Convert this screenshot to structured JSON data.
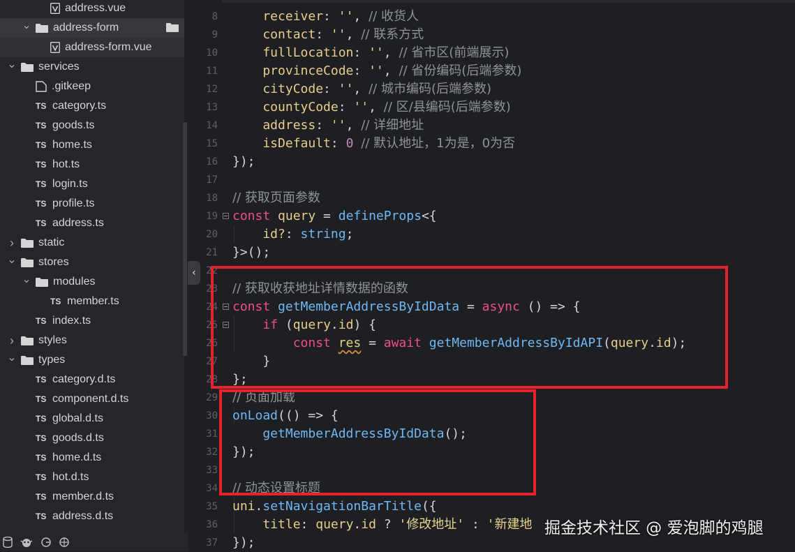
{
  "sidebar": {
    "items": [
      {
        "label": "address.vue",
        "type": "vue",
        "indent": 3,
        "arrow": ""
      },
      {
        "label": "address-form",
        "type": "folder",
        "indent": 2,
        "arrow": "down",
        "state": "hl"
      },
      {
        "label": "address-form.vue",
        "type": "vue",
        "indent": 3,
        "arrow": "",
        "state": "sel"
      },
      {
        "label": "services",
        "type": "folder",
        "indent": 1,
        "arrow": "down"
      },
      {
        "label": ".gitkeep",
        "type": "file",
        "indent": 2,
        "arrow": ""
      },
      {
        "label": "category.ts",
        "type": "ts",
        "indent": 2,
        "arrow": ""
      },
      {
        "label": "goods.ts",
        "type": "ts",
        "indent": 2,
        "arrow": ""
      },
      {
        "label": "home.ts",
        "type": "ts",
        "indent": 2,
        "arrow": ""
      },
      {
        "label": "hot.ts",
        "type": "ts",
        "indent": 2,
        "arrow": ""
      },
      {
        "label": "login.ts",
        "type": "ts",
        "indent": 2,
        "arrow": ""
      },
      {
        "label": "profile.ts",
        "type": "ts",
        "indent": 2,
        "arrow": ""
      },
      {
        "label": "address.ts",
        "type": "ts",
        "indent": 2,
        "arrow": ""
      },
      {
        "label": "static",
        "type": "folder",
        "indent": 1,
        "arrow": "right"
      },
      {
        "label": "stores",
        "type": "folder",
        "indent": 1,
        "arrow": "down"
      },
      {
        "label": "modules",
        "type": "folder",
        "indent": 2,
        "arrow": "down"
      },
      {
        "label": "member.ts",
        "type": "ts",
        "indent": 3,
        "arrow": ""
      },
      {
        "label": "index.ts",
        "type": "ts",
        "indent": 2,
        "arrow": ""
      },
      {
        "label": "styles",
        "type": "folder",
        "indent": 1,
        "arrow": "right"
      },
      {
        "label": "types",
        "type": "folder",
        "indent": 1,
        "arrow": "down"
      },
      {
        "label": "category.d.ts",
        "type": "ts",
        "indent": 2,
        "arrow": ""
      },
      {
        "label": "component.d.ts",
        "type": "ts",
        "indent": 2,
        "arrow": ""
      },
      {
        "label": "global.d.ts",
        "type": "ts",
        "indent": 2,
        "arrow": ""
      },
      {
        "label": "goods.d.ts",
        "type": "ts",
        "indent": 2,
        "arrow": ""
      },
      {
        "label": "home.d.ts",
        "type": "ts",
        "indent": 2,
        "arrow": ""
      },
      {
        "label": "hot.d.ts",
        "type": "ts",
        "indent": 2,
        "arrow": ""
      },
      {
        "label": "member.d.ts",
        "type": "ts",
        "indent": 2,
        "arrow": ""
      },
      {
        "label": "address.d.ts",
        "type": "ts",
        "indent": 2,
        "arrow": ""
      }
    ],
    "ts_badge": "TS",
    "bottom_icons": [
      "database-icon",
      "bug-icon",
      "source-control-icon",
      "plugin-icon"
    ]
  },
  "editor": {
    "line_numbers": [
      "8",
      "9",
      "10",
      "11",
      "12",
      "13",
      "14",
      "15",
      "16",
      "17",
      "18",
      "19",
      "20",
      "21",
      "22",
      "23",
      "24",
      "25",
      "26",
      "27",
      "28",
      "29",
      "30",
      "31",
      "32",
      "33",
      "34",
      "35",
      "36",
      "37"
    ],
    "lines": [
      [
        [
          "pr",
          "    receiver"
        ],
        [
          "pu",
          ": "
        ],
        [
          "st",
          "''"
        ],
        [
          "pu",
          ", "
        ],
        [
          "cm",
          "// 收货人"
        ]
      ],
      [
        [
          "pr",
          "    contact"
        ],
        [
          "pu",
          ": "
        ],
        [
          "st",
          "''"
        ],
        [
          "pu",
          ", "
        ],
        [
          "cm",
          "// 联系方式"
        ]
      ],
      [
        [
          "pr",
          "    fullLocation"
        ],
        [
          "pu",
          ": "
        ],
        [
          "st",
          "''"
        ],
        [
          "pu",
          ", "
        ],
        [
          "cm",
          "// 省市区(前端展示)"
        ]
      ],
      [
        [
          "pr",
          "    provinceCode"
        ],
        [
          "pu",
          ": "
        ],
        [
          "st",
          "''"
        ],
        [
          "pu",
          ", "
        ],
        [
          "cm",
          "// 省份编码(后端参数)"
        ]
      ],
      [
        [
          "pr",
          "    cityCode"
        ],
        [
          "pu",
          ": "
        ],
        [
          "st",
          "''"
        ],
        [
          "pu",
          ", "
        ],
        [
          "cm",
          "// 城市编码(后端参数)"
        ]
      ],
      [
        [
          "pr",
          "    countyCode"
        ],
        [
          "pu",
          ": "
        ],
        [
          "st",
          "''"
        ],
        [
          "pu",
          ", "
        ],
        [
          "cm",
          "// 区/县编码(后端参数)"
        ]
      ],
      [
        [
          "pr",
          "    address"
        ],
        [
          "pu",
          ": "
        ],
        [
          "st",
          "''"
        ],
        [
          "pu",
          ", "
        ],
        [
          "cm",
          "// 详细地址"
        ]
      ],
      [
        [
          "pr",
          "    isDefault"
        ],
        [
          "pu",
          ": "
        ],
        [
          "num",
          "0"
        ],
        [
          "pu",
          " "
        ],
        [
          "cm",
          "// 默认地址，1为是，0为否"
        ]
      ],
      [
        [
          "pu",
          "});"
        ]
      ],
      [],
      [
        [
          "cm",
          "// 获取页面参数"
        ]
      ],
      [
        [
          "kw",
          "const "
        ],
        [
          "var",
          "query"
        ],
        [
          "pu",
          " = "
        ],
        [
          "fn",
          "defineProps"
        ],
        [
          "pu",
          "<{"
        ]
      ],
      [
        [
          "pr",
          "    id?"
        ],
        [
          "pu",
          ": "
        ],
        [
          "ty",
          "string"
        ],
        [
          "pu",
          ";"
        ]
      ],
      [
        [
          "pu",
          "}>();"
        ]
      ],
      [],
      [
        [
          "cm",
          "// 获取收获地址详情数据的函数"
        ]
      ],
      [
        [
          "kw",
          "const "
        ],
        [
          "fn",
          "getMemberAddressByIdData"
        ],
        [
          "pu",
          " = "
        ],
        [
          "kw",
          "async"
        ],
        [
          "pu",
          " () => {"
        ]
      ],
      [
        [
          "kw",
          "    if"
        ],
        [
          "pu",
          " ("
        ],
        [
          "var",
          "query"
        ],
        [
          "pu",
          "."
        ],
        [
          "pr",
          "id"
        ],
        [
          "pu",
          ") {"
        ]
      ],
      [
        [
          "kw",
          "        const "
        ],
        [
          "sq",
          "res"
        ],
        [
          "pu",
          " = "
        ],
        [
          "kw",
          "await "
        ],
        [
          "fn",
          "getMemberAddressByIdAPI"
        ],
        [
          "pu",
          "("
        ],
        [
          "var",
          "query"
        ],
        [
          "pu",
          "."
        ],
        [
          "pr",
          "id"
        ],
        [
          "pu",
          ");"
        ]
      ],
      [
        [
          "pu",
          "    }"
        ]
      ],
      [
        [
          "pu",
          "};"
        ]
      ],
      [
        [
          "cm",
          "// 页面加载"
        ]
      ],
      [
        [
          "fn",
          "onLoad"
        ],
        [
          "pu",
          "(() => {"
        ]
      ],
      [
        [
          "fn",
          "    getMemberAddressByIdData"
        ],
        [
          "pu",
          "();"
        ]
      ],
      [
        [
          "pu",
          "});"
        ]
      ],
      [],
      [
        [
          "cm",
          "// 动态设置标题"
        ]
      ],
      [
        [
          "var",
          "uni"
        ],
        [
          "pu",
          "."
        ],
        [
          "fn",
          "setNavigationBarTitle"
        ],
        [
          "pu",
          "({"
        ]
      ],
      [
        [
          "pr",
          "    title"
        ],
        [
          "pu",
          ": "
        ],
        [
          "var",
          "query"
        ],
        [
          "pu",
          "."
        ],
        [
          "pr",
          "id"
        ],
        [
          "pu",
          " ? "
        ],
        [
          "st",
          "'修改地址'"
        ],
        [
          "pu",
          " : "
        ],
        [
          "st",
          "'新建地"
        ]
      ],
      [
        [
          "pu",
          "});"
        ]
      ]
    ],
    "fold_markers": [
      11,
      16,
      17
    ]
  },
  "watermark": "掘金技术社区 @ 爱泡脚的鸡腿",
  "colors": {
    "annotation": "#e8222a",
    "background": "#1e1f22",
    "sidebar": "#25262a"
  }
}
